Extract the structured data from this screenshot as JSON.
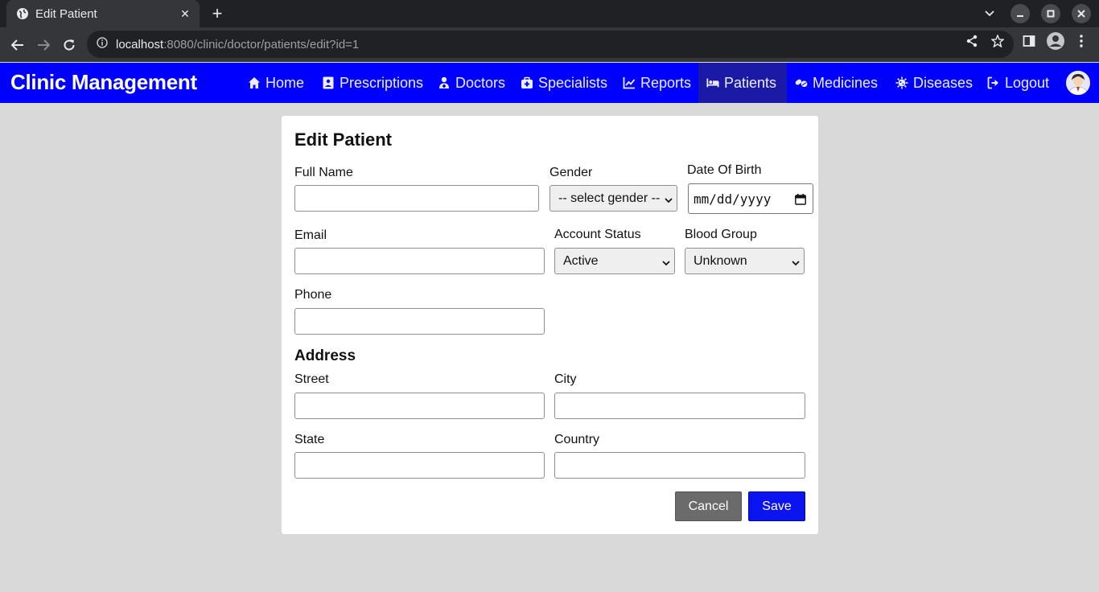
{
  "browser": {
    "tab_title": "Edit Patient",
    "url_host": "localhost",
    "url_rest": ":8080/clinic/doctor/patients/edit?id=1"
  },
  "app": {
    "brand": "Clinic Management",
    "nav": [
      {
        "label": "Home",
        "icon": "home-icon"
      },
      {
        "label": "Prescriptions",
        "icon": "prescription-icon"
      },
      {
        "label": "Doctors",
        "icon": "doctor-icon"
      },
      {
        "label": "Specialists",
        "icon": "medkit-icon"
      },
      {
        "label": "Reports",
        "icon": "chart-line-icon"
      },
      {
        "label": "Patients",
        "icon": "bed-icon",
        "active": true
      },
      {
        "label": "Medicines",
        "icon": "pills-icon"
      },
      {
        "label": "Diseases",
        "icon": "virus-icon"
      },
      {
        "label": "Logout",
        "icon": "logout-icon"
      }
    ]
  },
  "form": {
    "title": "Edit Patient",
    "full_name_label": "Full Name",
    "full_name_value": "",
    "gender_label": "Gender",
    "gender_value": "-- select gender --",
    "dob_label": "Date Of Birth",
    "dob_placeholder": "mm/dd/yyyy",
    "email_label": "Email",
    "email_value": "",
    "account_status_label": "Account Status",
    "account_status_value": "Active",
    "blood_group_label": "Blood Group",
    "blood_group_value": "Unknown",
    "phone_label": "Phone",
    "phone_value": "",
    "address_heading": "Address",
    "street_label": "Street",
    "city_label": "City",
    "state_label": "State",
    "country_label": "Country",
    "cancel_label": "Cancel",
    "save_label": "Save"
  },
  "colors": {
    "nav_bg": "#0000ff",
    "nav_active": "#1a1aa6",
    "save_bg": "#0a14f0",
    "cancel_bg": "#6b6b6b",
    "page_bg": "#d9d9d9"
  }
}
